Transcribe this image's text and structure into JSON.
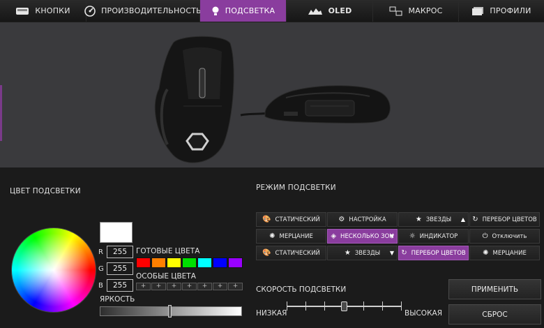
{
  "tabs": [
    {
      "label": "КНОПКИ",
      "icon": "buttons-icon",
      "active": false
    },
    {
      "label": "ПРОИЗВОДИТЕЛЬНОСТЬ",
      "icon": "performance-icon",
      "active": false
    },
    {
      "label": "ПОДСВЕТКА",
      "icon": "lighting-icon",
      "active": true
    },
    {
      "label": "OLED",
      "icon": "oled-icon",
      "active": false
    },
    {
      "label": "МАКРОС",
      "icon": "macro-icon",
      "active": false
    },
    {
      "label": "ПРОФИЛИ",
      "icon": "profiles-icon",
      "active": false
    }
  ],
  "color_section": {
    "title": "ЦВЕТ ПОДСВЕТКИ",
    "selected_color": "#ffffff",
    "r_label": "R",
    "g_label": "G",
    "b_label": "B",
    "r": "255",
    "g": "255",
    "b": "255",
    "preset_title": "ГОТОВЫЕ ЦВЕТА",
    "presets": [
      "#ff0000",
      "#ff7f00",
      "#ffff00",
      "#00e000",
      "#00ffff",
      "#0000ff",
      "#9900ff"
    ],
    "custom_title": "ОСОБЫЕ ЦВЕТА",
    "custom_slot": "+",
    "custom_count": 7,
    "brightness_title": "ЯРКОСТЬ",
    "brightness": 0.49
  },
  "mode_section": {
    "title": "РЕЖИМ ПОДСВЕТКИ",
    "rows": [
      [
        {
          "label": "СТАТИЧЕСКИЙ",
          "icon": "palette-icon",
          "active": false
        },
        {
          "label": "НАСТРОЙКА",
          "icon": "gear-icon",
          "active": false
        },
        {
          "label": "ЗВЕЗДЫ",
          "icon": "star-icon",
          "active": false,
          "arrow": "▲"
        },
        {
          "label": "ПЕРЕБОР ЦВЕТОВ",
          "icon": "cycle-icon",
          "active": false
        }
      ],
      [
        {
          "label": "МЕРЦАНИЕ",
          "icon": "breathing-icon",
          "active": false
        },
        {
          "label": "НЕСКОЛЬКО ЗОН",
          "icon": "layers-icon",
          "active": true,
          "arrow": "▼"
        },
        {
          "label": "ИНДИКАТОР",
          "icon": "bulb-icon",
          "active": false
        },
        {
          "label": "Отключить",
          "icon": "power-icon",
          "active": false
        }
      ],
      [
        {
          "label": "СТАТИЧЕСКИЙ",
          "icon": "palette-icon",
          "active": false
        },
        {
          "label": "ЗВЕЗДЫ",
          "icon": "star-icon",
          "active": false,
          "arrow": "▼"
        },
        {
          "label": "ПЕРЕБОР ЦВЕТОВ",
          "icon": "cycle-icon",
          "active": true
        },
        {
          "label": "МЕРЦАНИЕ",
          "icon": "breathing-icon",
          "active": false
        }
      ]
    ],
    "speed_title": "СКОРОСТЬ ПОДСВЕТКИ",
    "speed_low": "НИЗКАЯ",
    "speed_high": "ВЫСОКАЯ",
    "speed_level": 0.5
  },
  "actions": {
    "apply": "ПРИМЕНИТЬ",
    "reset": "СБРОС"
  },
  "colors": {
    "accent": "#8a3d9e",
    "preview_bg": "#3a3a3d",
    "panel_bg": "#1b1b1b"
  }
}
